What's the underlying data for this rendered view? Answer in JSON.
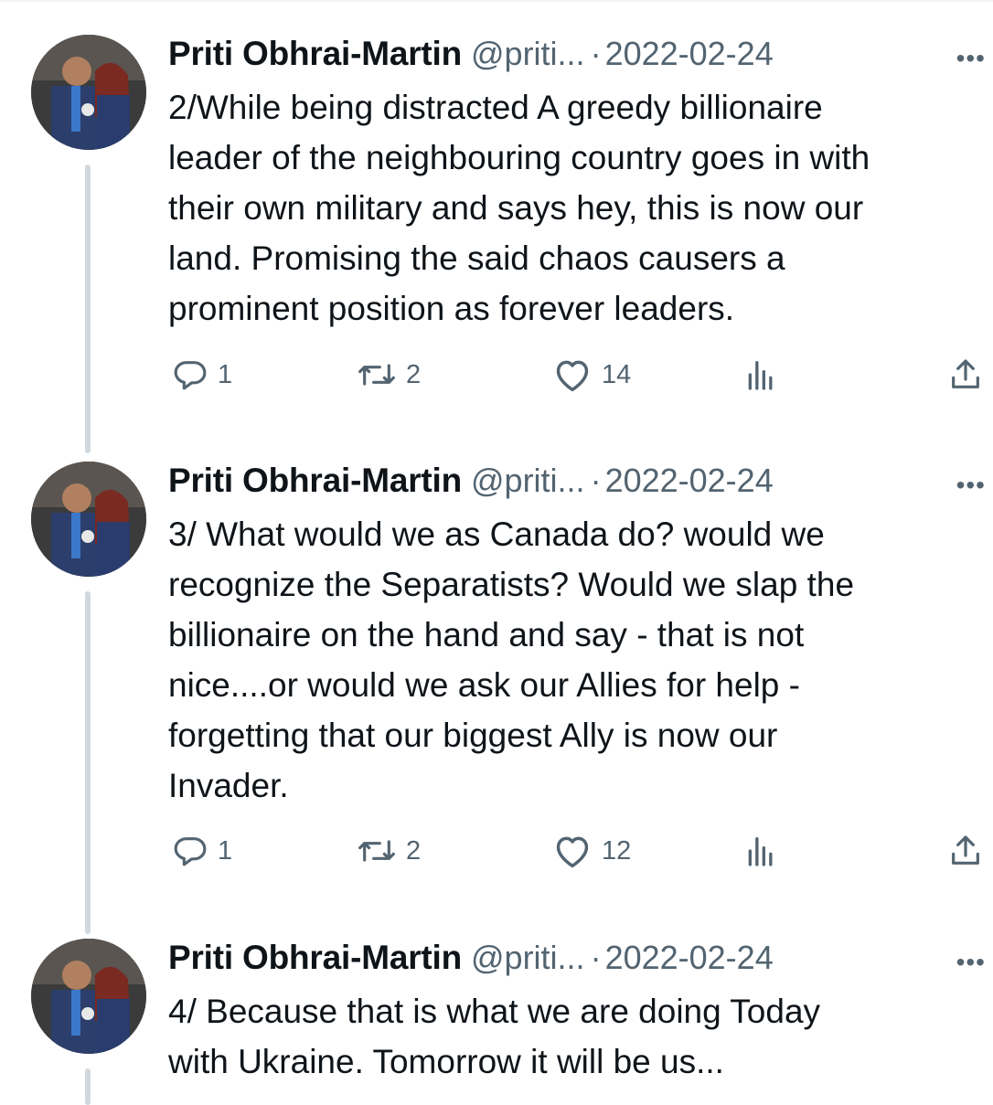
{
  "tweets": [
    {
      "author": "Priti Obhrai-Martin",
      "handle": "@priti...",
      "separator": "·",
      "date": "2022-02-24",
      "more": "•••",
      "text": "2/While being distracted A greedy billionaire\nleader of the neighbouring country goes in with\ntheir own military and says hey, this is now our\nland. Promising the said chaos causers a\nprominent position as forever leaders.",
      "replies": "1",
      "retweets": "2",
      "likes": "14"
    },
    {
      "author": "Priti Obhrai-Martin",
      "handle": "@priti...",
      "separator": "·",
      "date": "2022-02-24",
      "more": "•••",
      "text": "3/ What would we as Canada do? would we\nrecognize the Separatists? Would we slap the\nbillionaire on the hand and say - that is not\nnice....or would we ask our Allies for help -\nforgetting that our biggest Ally is now our\nInvader.",
      "replies": "1",
      "retweets": "2",
      "likes": "12"
    },
    {
      "author": "Priti Obhrai-Martin",
      "handle": "@priti...",
      "separator": "·",
      "date": "2022-02-24",
      "more": "•••",
      "text": "4/ Because that is what we are doing Today\nwith Ukraine.  Tomorrow it will be us..."
    }
  ],
  "icons": {
    "reply": "reply-icon",
    "retweet": "retweet-icon",
    "like": "heart-icon",
    "views": "analytics-icon",
    "share": "share-icon"
  },
  "colors": {
    "text": "#0f1419",
    "secondary": "#536471",
    "thread_line": "#cfd9de"
  }
}
